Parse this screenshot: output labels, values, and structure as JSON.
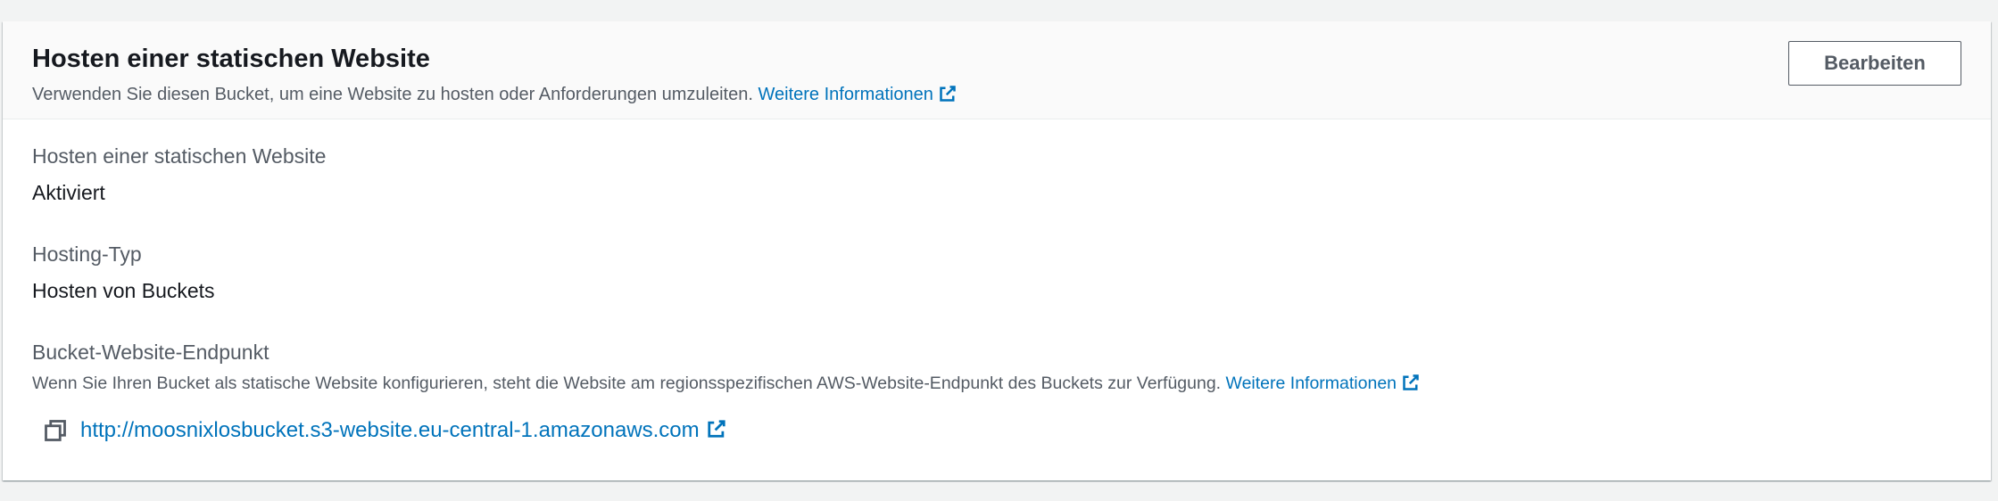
{
  "panel": {
    "title": "Hosten einer statischen Website",
    "description": "Verwenden Sie diesen Bucket, um eine Website zu hosten oder Anforderungen umzuleiten.",
    "description_link": "Weitere Informationen",
    "edit_button": "Bearbeiten"
  },
  "fields": {
    "static_hosting": {
      "label": "Hosten einer statischen Website",
      "value": "Aktiviert"
    },
    "hosting_type": {
      "label": "Hosting-Typ",
      "value": "Hosten von Buckets"
    },
    "endpoint": {
      "label": "Bucket-Website-Endpunkt",
      "description": "Wenn Sie Ihren Bucket als statische Website konfigurieren, steht die Website am regionsspezifischen AWS-Website-Endpunkt des Buckets zur Verfügung.",
      "description_link": "Weitere Informationen",
      "url": "http://moosnixlosbucket.s3-website.eu-central-1.amazonaws.com"
    }
  },
  "icons": {
    "external_link": "external-link-icon",
    "copy": "copy-icon"
  },
  "colors": {
    "link": "#0073bb",
    "title": "#16191f",
    "secondary_text": "#545b64",
    "header_background": "#fafafa",
    "page_background": "#f2f3f3"
  }
}
